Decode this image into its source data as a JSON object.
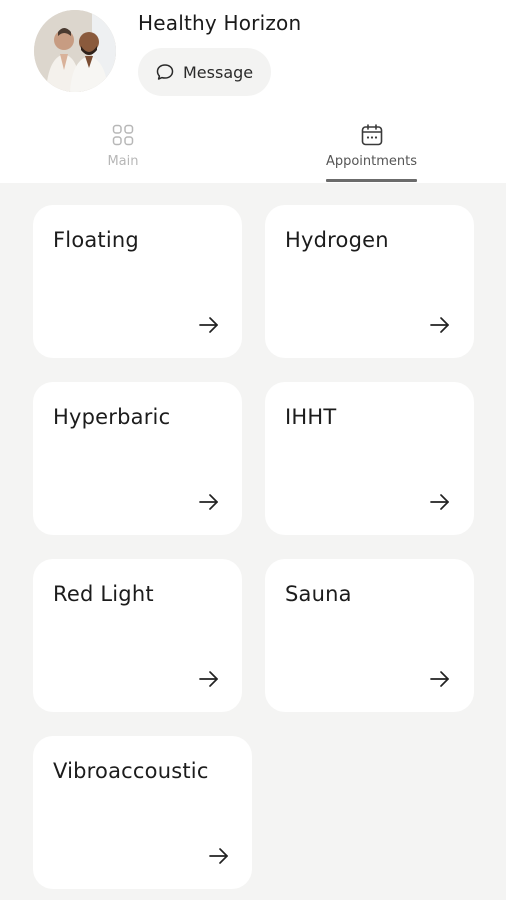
{
  "profile": {
    "name": "Healthy Horizon",
    "message_label": "Message"
  },
  "tabs": [
    {
      "label": "Main",
      "icon": "grid-icon",
      "active": false
    },
    {
      "label": "Appointments",
      "icon": "calendar-icon",
      "active": true
    }
  ],
  "services": [
    {
      "label": "Floating"
    },
    {
      "label": "Hydrogen"
    },
    {
      "label": "Hyperbaric"
    },
    {
      "label": "IHHT"
    },
    {
      "label": "Red Light"
    },
    {
      "label": "Sauna"
    },
    {
      "label": "Vibroaccoustic"
    }
  ],
  "colors": {
    "page_background": "#f4f4f3",
    "card_background": "#ffffff",
    "active_tab_indicator": "#6b6b6b",
    "inactive_tab_text": "#b7b7b7"
  }
}
